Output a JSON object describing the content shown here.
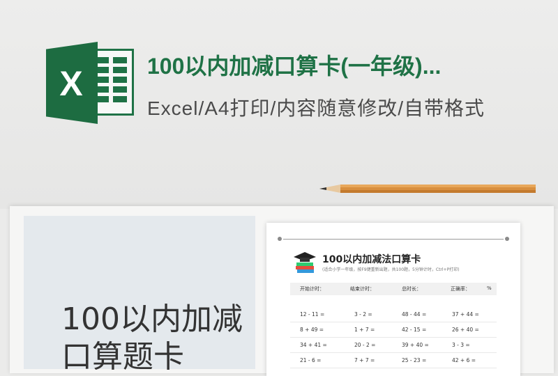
{
  "banner": {
    "title": "100以内加减口算卡(一年级)...",
    "subtitle": "Excel/A4打印/内容随意修改/自带格式",
    "logo_letter": "X",
    "brand_color": "#1f7246"
  },
  "preview": {
    "big_title_line1": "100以内加减",
    "big_title_line2": "口算题卡",
    "card": {
      "title": "100以内加减法口算卡",
      "note": "(适合小学一年级，按F9键重新出题，共100题，5分钟计时，Ctrl+P打印)",
      "headers": [
        "开始计时：",
        "结束计时：",
        "总时长：",
        "正确率：",
        "%"
      ],
      "rows": [
        [
          "12  -  11  =",
          "3  -  2  =",
          "48  -  44  =",
          "37  +  44  ="
        ],
        [
          "8  +  49  =",
          "1  +  7  =",
          "42  -  15  =",
          "26  +  40  ="
        ],
        [
          "34  +  41  =",
          "20  -  2  =",
          "39  +  40  =",
          "3  -  3  ="
        ],
        [
          "21  -  6  =",
          "7  +  7  =",
          "25  -  23  =",
          "42  +  6  ="
        ]
      ]
    }
  }
}
